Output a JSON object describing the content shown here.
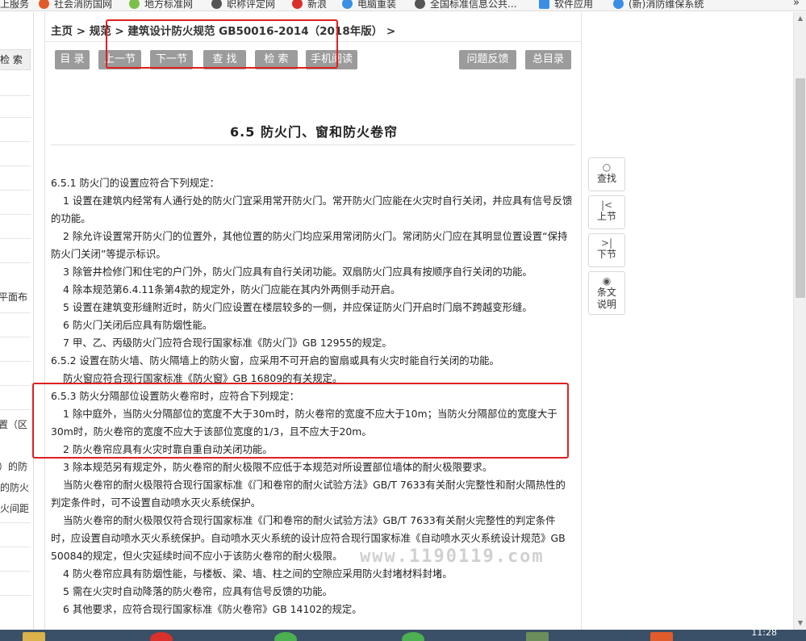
{
  "bookmarks": [
    {
      "label": "上服务",
      "color": "#ffffff"
    },
    {
      "label": "社会消防国网",
      "color": "#e25b2a"
    },
    {
      "label": "地方标准网",
      "color": "#7cc04a"
    },
    {
      "label": "职称评定网",
      "color": "#555555"
    },
    {
      "label": "新浪",
      "color": "#d9302b"
    },
    {
      "label": "电脑重装",
      "color": "#3a8ee6"
    },
    {
      "label": "全国标准信息公共...",
      "color": "#555555"
    },
    {
      "label": "软件应用",
      "color": "#3a8ee6"
    },
    {
      "label": "(新)消防维保系统",
      "color": "#3a8ee6"
    }
  ],
  "bookmarks_more": "»",
  "sidebar": {
    "search_tab": "检 索",
    "fragments": [
      "平面布",
      "置（区",
      "）的防",
      "的防火",
      "火间距"
    ]
  },
  "breadcrumb": "主页 > 规范 > 建筑设计防火规范 GB50016-2014（2018年版） >",
  "toolbar": {
    "toc": "目 录",
    "prev": "上一节",
    "next": "下一节",
    "find": "查 找",
    "search": "检 索",
    "mobile": "手机阅读",
    "feedback": "问题反馈",
    "index": "总目录"
  },
  "section_title": "6.5 防火门、窗和防火卷帘",
  "paragraphs": [
    {
      "text": "6.5.1 防火门的设置应符合下列规定：",
      "indent": false
    },
    {
      "text": "1 设置在建筑内经常有人通行处的防火门宜采用常开防火门。常开防火门应能在火灾时自行关闭，并应具有信号反馈的功能。",
      "indent": true
    },
    {
      "text": "2 除允许设置常开防火门的位置外，其他位置的防火门均应采用常闭防火门。常闭防火门应在其明显位置设置“保持防火门关闭”等提示标识。",
      "indent": true
    },
    {
      "text": "3 除管井检修门和住宅的户门外，防火门应具有自行关闭功能。双扇防火门应具有按顺序自行关闭的功能。",
      "indent": true
    },
    {
      "text": "4 除本规范第6.4.11条第4款的规定外，防火门应能在其内外两侧手动开启。",
      "indent": true
    },
    {
      "text": "5 设置在建筑变形缝附近时，防火门应设置在楼层较多的一侧，并应保证防火门开启时门扇不跨越变形缝。",
      "indent": true
    },
    {
      "text": "6 防火门关闭后应具有防烟性能。",
      "indent": true
    },
    {
      "text": "7 甲、乙、丙级防火门应符合现行国家标准《防火门》GB 12955的规定。",
      "indent": true
    },
    {
      "text": "6.5.2 设置在防火墙、防火隔墙上的防火窗，应采用不可开启的窗扇或具有火灾时能自行关闭的功能。",
      "indent": false
    },
    {
      "text": "防火窗应符合现行国家标准《防火窗》GB 16809的有关规定。",
      "indent": true
    },
    {
      "text": "6.5.3 防火分隔部位设置防火卷帘时，应符合下列规定：",
      "indent": false
    },
    {
      "text": "1 除中庭外，当防火分隔部位的宽度不大于30m时，防火卷帘的宽度不应大于10m；当防火分隔部位的宽度大于30m时，防火卷帘的宽度不应大于该部位宽度的1/3，且不应大于20m。",
      "indent": true
    },
    {
      "text": "2 防火卷帘应具有火灾时靠自重自动关闭功能。",
      "indent": true
    },
    {
      "text": "3 除本规范另有规定外，防火卷帘的耐火极限不应低于本规范对所设置部位墙体的耐火极限要求。",
      "indent": true
    },
    {
      "text": "当防火卷帘的耐火极限符合现行国家标准《门和卷帘的耐火试验方法》GB/T 7633有关耐火完整性和耐火隔热性的判定条件时，可不设置自动喷水灭火系统保护。",
      "indent": true
    },
    {
      "text": "当防火卷帘的耐火极限仅符合现行国家标准《门和卷帘的耐火试验方法》GB/T 7633有关耐火完整性的判定条件时，应设置自动喷水灭火系统保护。自动喷水灭火系统的设计应符合现行国家标准《自动喷水灭火系统设计规范》GB 50084的规定，但火灾延续时间不应小于该防火卷帘的耐火极限。",
      "indent": true
    },
    {
      "text": "4 防火卷帘应具有防烟性能，与楼板、梁、墙、柱之间的空隙应采用防火封堵材料封堵。",
      "indent": true
    },
    {
      "text": "5 需在火灾时自动降落的防火卷帘，应具有信号反馈的功能。",
      "indent": true
    },
    {
      "text": "6 其他要求，应符合现行国家标准《防火卷帘》GB 14102的规定。",
      "indent": true
    }
  ],
  "watermark": "www.1190119.com",
  "right_toolbar": {
    "find_icon": "○",
    "find": "查找",
    "prev_icon": "|<",
    "prev": "上节",
    "next_icon": ">|",
    "next": "下节",
    "note_icon": "◉",
    "note": "条文说明"
  },
  "taskbar": {
    "clock": "11:28"
  },
  "colors": {
    "highlight": "#e02020",
    "button": "#9b9b9b"
  }
}
